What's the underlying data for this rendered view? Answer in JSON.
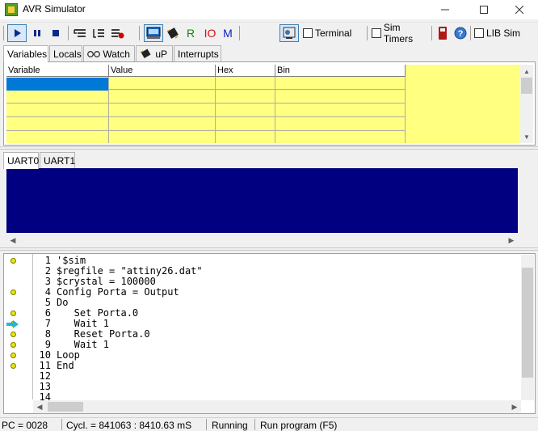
{
  "window": {
    "title": "AVR Simulator"
  },
  "toolbar": {
    "icons": [
      "play-icon",
      "pause-icon",
      "stop-icon",
      "step-into-icon",
      "step-over-icon",
      "run-to-breakpoint-icon",
      "lcd-icon",
      "chip-icon",
      "register-icon",
      "io-icon",
      "memory-icon",
      "terminal-icon",
      "remote-icon",
      "help-icon"
    ],
    "r_label": "R",
    "io_label": "IO",
    "m_label": "M",
    "terminal_label": "Terminal",
    "sim_timers_label": "Sim Timers",
    "lib_sim_label": "LIB Sim"
  },
  "tabs": [
    {
      "label": "Variables"
    },
    {
      "label": "Locals"
    },
    {
      "label": "Watch"
    },
    {
      "label": "uP"
    },
    {
      "label": "Interrupts"
    }
  ],
  "variables_grid": {
    "columns": [
      "Variable",
      "Value",
      "Hex",
      "Bin"
    ]
  },
  "uart_tabs": [
    {
      "label": "UART0"
    },
    {
      "label": "UART1"
    }
  ],
  "code": {
    "lines": [
      {
        "num": "1",
        "text": "'$sim",
        "breakpoint": true,
        "current": false
      },
      {
        "num": "2",
        "text": "$regfile = \"attiny26.dat\"",
        "breakpoint": false,
        "current": false
      },
      {
        "num": "3",
        "text": "$crystal = 100000",
        "breakpoint": false,
        "current": false
      },
      {
        "num": "4",
        "text": "Config Porta = Output",
        "breakpoint": true,
        "current": false
      },
      {
        "num": "5",
        "text": "Do",
        "breakpoint": false,
        "current": false
      },
      {
        "num": "6",
        "text": "   Set Porta.0",
        "breakpoint": true,
        "current": false
      },
      {
        "num": "7",
        "text": "   Wait 1",
        "breakpoint": true,
        "current": true
      },
      {
        "num": "8",
        "text": "   Reset Porta.0",
        "breakpoint": true,
        "current": false
      },
      {
        "num": "9",
        "text": "   Wait 1",
        "breakpoint": true,
        "current": false
      },
      {
        "num": "10",
        "text": "Loop",
        "breakpoint": true,
        "current": false
      },
      {
        "num": "11",
        "text": "End",
        "breakpoint": true,
        "current": false
      },
      {
        "num": "12",
        "text": "",
        "breakpoint": false,
        "current": false
      },
      {
        "num": "13",
        "text": "",
        "breakpoint": false,
        "current": false
      },
      {
        "num": "14",
        "text": "",
        "breakpoint": false,
        "current": false
      }
    ]
  },
  "status": {
    "pc": "PC = 0028",
    "cycles": "Cycl. = 841063 : 8410.63 mS",
    "state": "Running",
    "hint": "Run program (F5)"
  },
  "colors": {
    "grid_bg": "#ffff80",
    "uart_bg": "#000080",
    "selection": "#0078d7",
    "breakpoint": "#e8e800",
    "current_arrow": "#1fb6e0"
  }
}
